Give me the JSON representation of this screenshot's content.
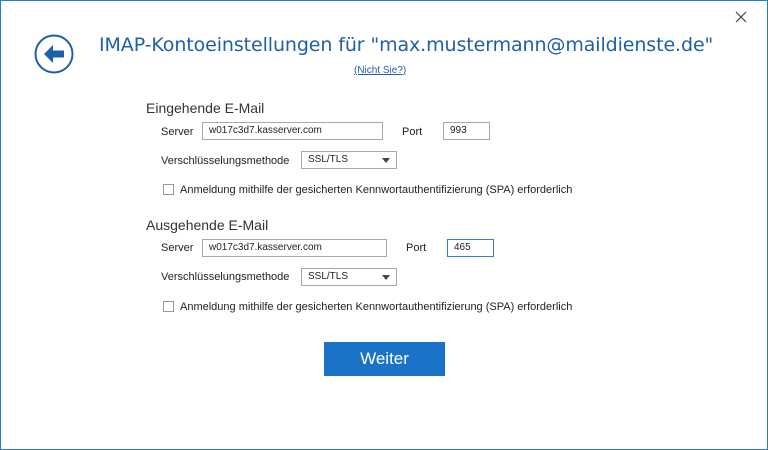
{
  "window": {
    "title": "IMAP-Kontoeinstellungen für \"max.mustermann@maildienste.de\"",
    "not_you_link": "(Nicht Sie?)"
  },
  "incoming": {
    "heading": "Eingehende E-Mail",
    "server_label": "Server",
    "server_value": "w017c3d7.kasserver.com",
    "port_label": "Port",
    "port_value": "993",
    "encryption_label": "Verschlüsselungsmethode",
    "encryption_value": "SSL/TLS",
    "spa_label": "Anmeldung mithilfe der gesicherten Kennwortauthentifizierung (SPA) erforderlich",
    "spa_checked": false
  },
  "outgoing": {
    "heading": "Ausgehende E-Mail",
    "server_label": "Server",
    "server_value": "w017c3d7.kasserver.com",
    "port_label": "Port",
    "port_value": "465",
    "encryption_label": "Verschlüsselungsmethode",
    "encryption_value": "SSL/TLS",
    "spa_label": "Anmeldung mithilfe der gesicherten Kennwortauthentifizierung (SPA) erforderlich",
    "spa_checked": false
  },
  "actions": {
    "next_label": "Weiter"
  },
  "colors": {
    "accent": "#1b73c7",
    "title": "#1e5fa8",
    "border": "#2b79c7"
  },
  "icons": {
    "back": "back-arrow-icon",
    "close": "close-icon",
    "dropdown": "chevron-down-icon"
  }
}
